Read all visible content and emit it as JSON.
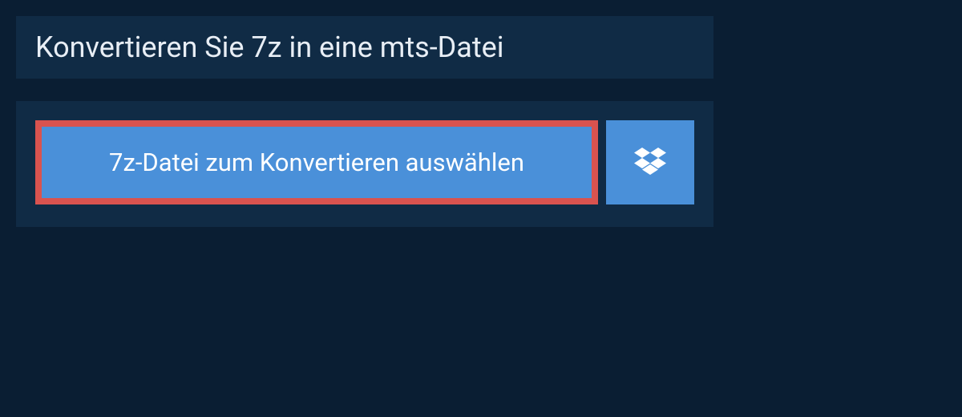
{
  "title": "Konvertieren Sie 7z in eine mts-Datei",
  "buttons": {
    "select_label": "7z-Datei zum Konvertieren auswählen"
  },
  "colors": {
    "background": "#0a1e33",
    "panel": "#102b45",
    "button": "#4a90d9",
    "highlight_border": "#d9534f"
  }
}
